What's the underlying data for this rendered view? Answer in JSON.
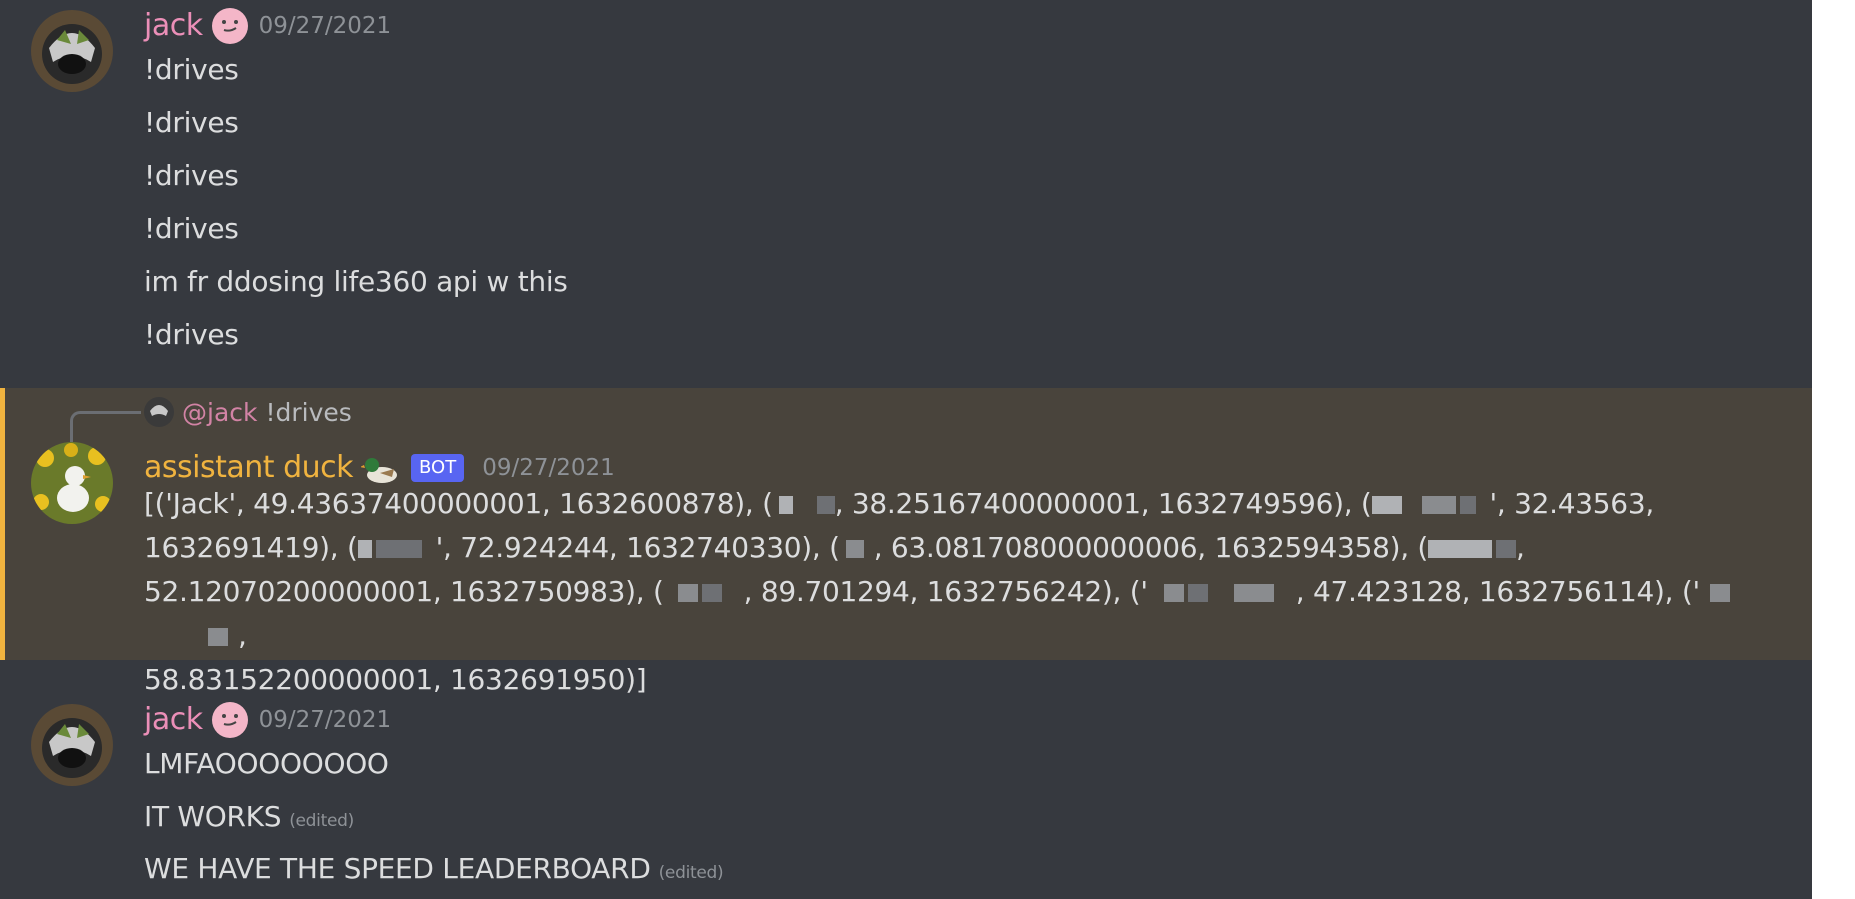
{
  "messages": [
    {
      "username": "jack",
      "timestamp": "09/27/2021",
      "lines": [
        "!drives",
        "!drives",
        "!drives",
        "!drives",
        "im fr ddosing life360 api w this",
        "!drives"
      ]
    },
    {
      "reply": {
        "mention": "@jack",
        "text": "!drives"
      },
      "username": "assistant duck",
      "badge": "BOT",
      "timestamp": "09/27/2021",
      "segments": [
        "[('Jack', 49.43637400000001, 1632600878), (",
        ", 38.25167400000001, 1632749596), (",
        "', 32.43563,",
        "1632691419), (",
        "', 72.924244, 1632740330), (",
        ", 63.081708000000006, 1632594358), (",
        ",",
        "52.12070200000001, 1632750983), (",
        ", 89.701294, 1632756242), ('",
        ", 47.423128, 1632756114), ('",
        ",",
        "58.83152200000001, 1632691950)]"
      ]
    },
    {
      "username": "jack",
      "timestamp": "09/27/2021",
      "lines": [
        "LMFAOOOOOOOO",
        "IT WORKS",
        "WE HAVE THE SPEED LEADERBOARD"
      ],
      "edited_label": "(edited)"
    }
  ],
  "colors": {
    "background": "#36393f",
    "jack": "#eb8fb8",
    "duck": "#f0b33f",
    "bot_badge": "#5865f2",
    "highlight": "#49443c"
  },
  "icons": [
    "avatar-jack",
    "pink-face-emoji",
    "avatar-duck",
    "duck-emoji"
  ]
}
